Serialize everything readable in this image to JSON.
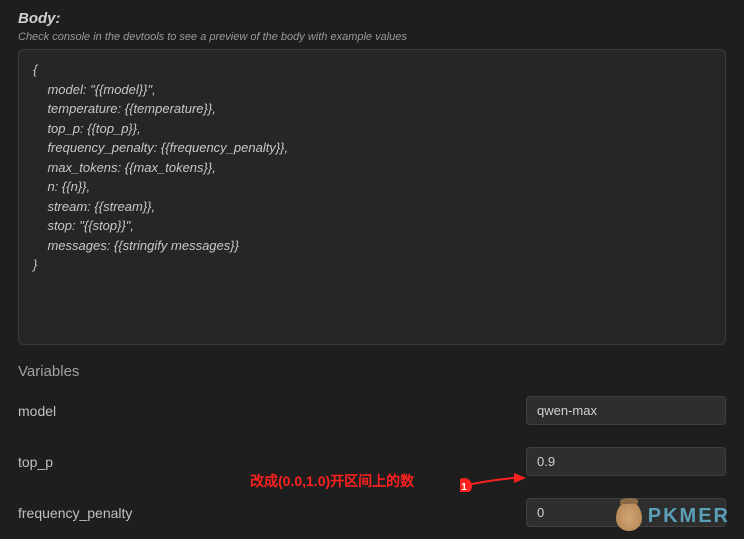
{
  "header": {
    "title": "Body:",
    "hint": "Check console in the devtools to see a preview of the body with example values"
  },
  "code_body": "{\n    model: \"{{model}}\",\n    temperature: {{temperature}},\n    top_p: {{top_p}},\n    frequency_penalty: {{frequency_penalty}},\n    max_tokens: {{max_tokens}},\n    n: {{n}},\n    stream: {{stream}},\n    stop: \"{{stop}}\",\n    messages: {{stringify messages}}\n}",
  "variables_section": {
    "title": "Variables"
  },
  "variables": {
    "model": {
      "label": "model",
      "value": "qwen-max"
    },
    "top_p": {
      "label": "top_p",
      "value": "0.9"
    },
    "frequency_penalty": {
      "label": "frequency_penalty",
      "value": "0"
    }
  },
  "annotation": {
    "text": "改成(0.0,1.0)开区间上的数",
    "marker": "1"
  },
  "watermark": {
    "text": "PKMER"
  }
}
